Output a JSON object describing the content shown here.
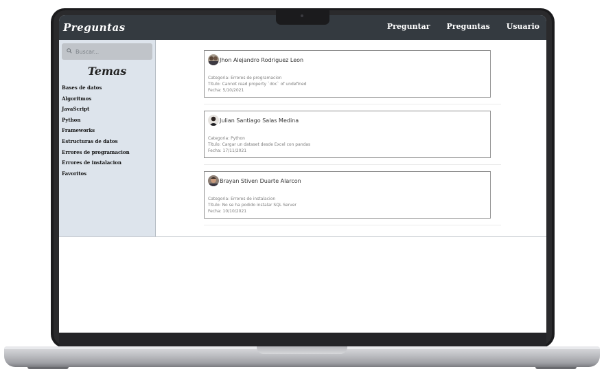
{
  "app": {
    "brand": "Preguntas"
  },
  "nav": {
    "items": [
      "Preguntar",
      "Preguntas",
      "Usuario"
    ]
  },
  "sidebar": {
    "search_placeholder": "Buscar...",
    "title": "Temas",
    "topics": [
      "Bases de datos",
      "Algoritmos",
      "JavaScript",
      "Python",
      "Frameworks",
      "Estructuras de datos",
      "Errores de programacion",
      "Errores de instalacion",
      "Favoritos"
    ]
  },
  "posts": [
    {
      "author": "Jhon Alejandro Rodriguez Leon",
      "category": "Categoria: Errores de programacion",
      "title": "Titulo: Cannot read property `doc` of undefined",
      "date": "Fecha: 5/10/2021"
    },
    {
      "author": "Julian Santiago Salas Medina",
      "category": "Categoria: Python",
      "title": "Titulo: Cargar un dataset desde Excel con pandas",
      "date": "Fecha: 17/11/2021"
    },
    {
      "author": "Brayan Stiven Duarte Alarcon",
      "category": "Categoria: Errores de instalacion",
      "title": "Titulo: No se ha podido instalar SQL Server",
      "date": "Fecha: 10/10/2021"
    }
  ]
}
